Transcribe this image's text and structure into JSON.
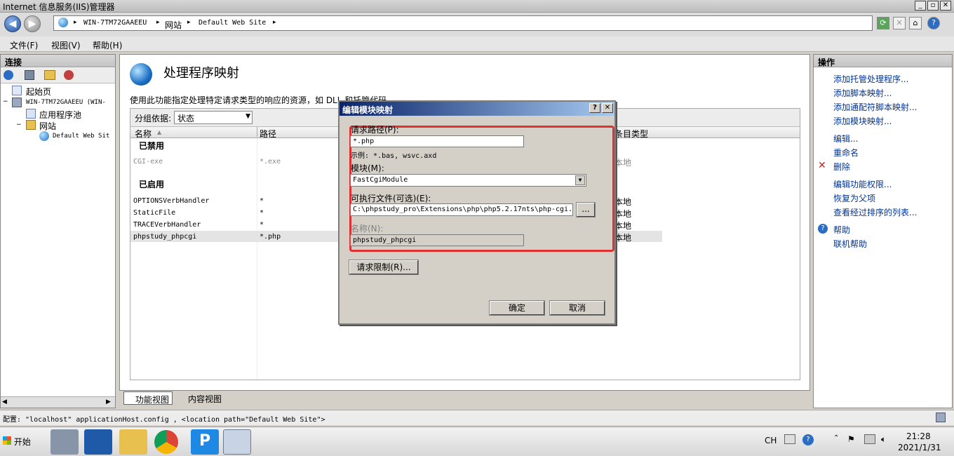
{
  "window": {
    "title": "Internet 信息服务(IIS)管理器"
  },
  "address": {
    "parts": [
      "WIN-7TM72GAAEEU",
      "网站",
      "Default Web Site"
    ],
    "sep": "▸"
  },
  "menu": {
    "file": "文件(F)",
    "view": "视图(V)",
    "help": "帮助(H)"
  },
  "left": {
    "header": "连接",
    "tree": {
      "start": "起始页",
      "server": "WIN-7TM72GAAEEU (WIN-",
      "apppools": "应用程序池",
      "sites": "网站",
      "defaultsite": "Default Web Sit"
    }
  },
  "center": {
    "title": "处理程序映射",
    "description": "使用此功能指定处理特定请求类型的响应的资源，如 DLL 和托管代码。",
    "group_label": "分组依据:",
    "group_value": "状态",
    "columns": {
      "name": "名称",
      "path": "路径",
      "type": "条目类型"
    },
    "disabled_group": "已禁用",
    "enabled_group": "已启用",
    "rows": [
      {
        "name": "CGI-exe",
        "path": "*.exe",
        "type": "本地",
        "disabled": true
      },
      {
        "name": "OPTIONSVerbHandler",
        "path": "*",
        "type": "本地",
        "disabled": false
      },
      {
        "name": "StaticFile",
        "path": "*",
        "type": "本地",
        "disabled": false
      },
      {
        "name": "TRACEVerbHandler",
        "path": "*",
        "type": "本地",
        "disabled": false
      },
      {
        "name": "phpstudy_phpcgi",
        "path": "*.php",
        "type": "本地",
        "disabled": false,
        "selected": true
      }
    ],
    "tab_features": "功能视图",
    "tab_content": "内容视图"
  },
  "dialog": {
    "title": "编辑模块映射",
    "help": "?",
    "close": "✕",
    "path_label": "请求路径(P):",
    "path_value": "*.php",
    "example": "示例: *.bas, wsvc.axd",
    "module_label": "模块(M):",
    "module_value": "FastCgiModule",
    "exe_label": "可执行文件(可选)(E):",
    "exe_value": "C:\\phpstudy_pro\\Extensions\\php\\php5.2.17nts\\php-cgi.exe",
    "browse": "...",
    "name_label": "名称(N):",
    "name_value": "phpstudy_phpcgi",
    "restrictions": "请求限制(R)...",
    "ok": "确定",
    "cancel": "取消"
  },
  "right": {
    "header": "操作",
    "actions": [
      "添加托管处理程序...",
      "添加脚本映射...",
      "添加通配符脚本映射...",
      "添加模块映射..."
    ],
    "edit": "编辑...",
    "rename": "重命名",
    "delete": "删除",
    "perms": "编辑功能权限...",
    "revert": "恢复为父项",
    "ordered": "查看经过排序的列表...",
    "help": "帮助",
    "online": "联机帮助"
  },
  "status": {
    "text": "配置: \"localhost\" applicationHost.config , <location path=\"Default Web Site\">"
  },
  "taskbar": {
    "start": "开始",
    "lang": "CH",
    "time": "21:28",
    "date": "2021/1/31"
  },
  "colors": {
    "highlight_box": "#e03030",
    "dialog_title": "#0a246a",
    "link": "#003399"
  }
}
